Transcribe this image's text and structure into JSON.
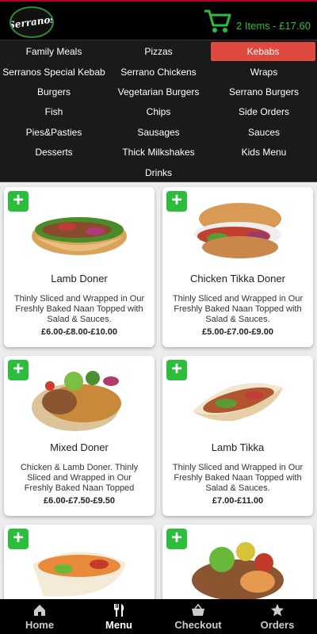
{
  "header": {
    "logo_text": "Serranos",
    "cart_label": "2 Items - £17.60",
    "cart_icon": "shopping-cart-icon",
    "accent": "#2dbd3c"
  },
  "categories": [
    {
      "label": "Family Meals",
      "active": false
    },
    {
      "label": "Pizzas",
      "active": false
    },
    {
      "label": "Kebabs",
      "active": true
    },
    {
      "label": "Serranos Special Kebab",
      "active": false
    },
    {
      "label": "Serrano Chickens",
      "active": false
    },
    {
      "label": "Wraps",
      "active": false
    },
    {
      "label": "Burgers",
      "active": false
    },
    {
      "label": "Vegetarian Burgers",
      "active": false
    },
    {
      "label": "Serrano Burgers",
      "active": false
    },
    {
      "label": "Fish",
      "active": false
    },
    {
      "label": "Chips",
      "active": false
    },
    {
      "label": "Side Orders",
      "active": false
    },
    {
      "label": "Pies&Pasties",
      "active": false
    },
    {
      "label": "Sausages",
      "active": false
    },
    {
      "label": "Sauces",
      "active": false
    },
    {
      "label": "Desserts",
      "active": false
    },
    {
      "label": "Thick Milkshakes",
      "active": false
    },
    {
      "label": "Kids Menu",
      "active": false
    },
    {
      "label": "Drinks",
      "active": false
    }
  ],
  "products": [
    {
      "name": "Lamb Doner",
      "description": "Thinly Sliced and Wrapped in Our Freshly Baked Naan Topped with Salad & Sauces.",
      "price": "£6.00-£8.00-£10.00"
    },
    {
      "name": "Chicken Tikka Doner",
      "description": "Thinly Sliced and Wrapped in Our Freshly Baked Naan Topped with Salad & Sauces.",
      "price": "£5.00-£7.00-£9.00"
    },
    {
      "name": "Mixed Doner",
      "description": "Chicken & Lamb Doner. Thinly Sliced and Wrapped in Our Freshly Baked Naan Topped",
      "price": "£6.00-£7.50-£9.50"
    },
    {
      "name": "Lamb Tikka",
      "description": "Thinly Sliced and Wrapped in Our Freshly Baked Naan Topped with Salad & Sauces.",
      "price": "£7.00-£11.00"
    },
    {
      "name": "",
      "description": "",
      "price": ""
    },
    {
      "name": "",
      "description": "",
      "price": ""
    }
  ],
  "add_symbol": "+",
  "nav": [
    {
      "label": "Home",
      "icon": "home-icon",
      "active": false
    },
    {
      "label": "Menu",
      "icon": "fork-knife-icon",
      "active": true
    },
    {
      "label": "Checkout",
      "icon": "basket-icon",
      "active": false
    },
    {
      "label": "Orders",
      "icon": "star-icon",
      "active": false
    }
  ]
}
